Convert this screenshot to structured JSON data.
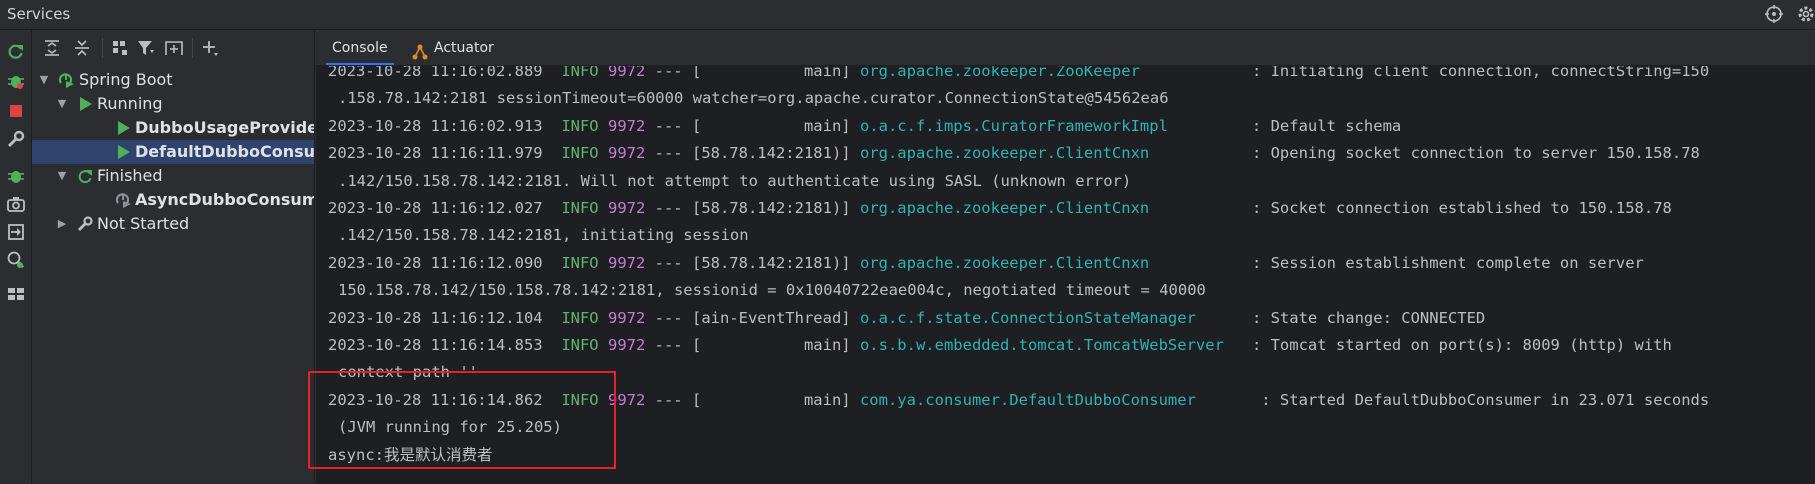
{
  "window": {
    "title": "Services"
  },
  "toolbar": {
    "buttons": [
      "expand-all-icon",
      "collapse-all-icon",
      "group-by-icon",
      "filter-icon",
      "new-tab-icon",
      "add-icon"
    ]
  },
  "side_toolbar": {
    "buttons": [
      "rerun-icon",
      "debug-icon",
      "stop-icon",
      "settings-icon",
      "debug-attach-icon",
      "screenshot-icon",
      "exit-icon",
      "profiler-icon",
      "layout-icon"
    ]
  },
  "tree": {
    "root": "Spring Boot",
    "running_group": "Running",
    "running_items": [
      "DubboUsageProviderAp",
      "DefaultDubboConsume"
    ],
    "finished_group": "Finished",
    "finished_items": [
      "AsyncDubboConsumer"
    ],
    "not_started_group": "Not Started"
  },
  "tabs": [
    {
      "label": "Console",
      "active": true
    },
    {
      "label": "Actuator",
      "active": false
    }
  ],
  "console": {
    "lines": [
      {
        "ts": "2023-10-28 11:16:02.889",
        "level": "INFO",
        "pid": "9972",
        "sep": " --- ",
        "thread": "[           main]",
        "logger": "org.apache.zookeeper.ZooKeeper",
        "pad": "           ",
        "msg": ": Initiating client connection, connectString=150"
      },
      {
        "cont": ".158.78.142:2181 sessionTimeout=60000 watcher=org.apache.curator.ConnectionState@54562ea6"
      },
      {
        "ts": "2023-10-28 11:16:02.913",
        "level": "INFO",
        "pid": "9972",
        "sep": " --- ",
        "thread": "[           main]",
        "logger": "o.a.c.f.imps.CuratorFrameworkImpl",
        "pad": "        ",
        "msg": ": Default schema"
      },
      {
        "ts": "2023-10-28 11:16:11.979",
        "level": "INFO",
        "pid": "9972",
        "sep": " --- ",
        "thread": "[58.78.142:2181)]",
        "logger": "org.apache.zookeeper.ClientCnxn",
        "pad": "          ",
        "msg": ": Opening socket connection to server 150.158.78"
      },
      {
        "cont": ".142/150.158.78.142:2181. Will not attempt to authenticate using SASL (unknown error)"
      },
      {
        "ts": "2023-10-28 11:16:12.027",
        "level": "INFO",
        "pid": "9972",
        "sep": " --- ",
        "thread": "[58.78.142:2181)]",
        "logger": "org.apache.zookeeper.ClientCnxn",
        "pad": "          ",
        "msg": ": Socket connection established to 150.158.78"
      },
      {
        "cont": ".142/150.158.78.142:2181, initiating session"
      },
      {
        "ts": "2023-10-28 11:16:12.090",
        "level": "INFO",
        "pid": "9972",
        "sep": " --- ",
        "thread": "[58.78.142:2181)]",
        "logger": "org.apache.zookeeper.ClientCnxn",
        "pad": "          ",
        "msg": ": Session establishment complete on server"
      },
      {
        "cont": "150.158.78.142/150.158.78.142:2181, sessionid = 0x10040722eae004c, negotiated timeout = 40000"
      },
      {
        "ts": "2023-10-28 11:16:12.104",
        "level": "INFO",
        "pid": "9972",
        "sep": " --- ",
        "thread": "[ain-EventThread]",
        "logger": "o.a.c.f.state.ConnectionStateManager",
        "pad": "     ",
        "msg": ": State change: CONNECTED"
      },
      {
        "ts": "2023-10-28 11:16:14.853",
        "level": "INFO",
        "pid": "9972",
        "sep": " --- ",
        "thread": "[           main]",
        "logger": "o.s.b.w.embedded.tomcat.TomcatWebServer",
        "pad": "  ",
        "msg": ": Tomcat started on port(s): 8009 (http) with"
      },
      {
        "cont": "context path ''"
      },
      {
        "ts": "2023-10-28 11:16:14.862",
        "level": "INFO",
        "pid": "9972",
        "sep": " --- ",
        "thread": "[           main]",
        "logger": "com.ya.consumer.DefaultDubboConsumer",
        "pad": "      ",
        "msg": ": Started DefaultDubboConsumer in 23.071 seconds"
      },
      {
        "cont": "(JVM running for 25.205)"
      },
      {
        "plain": "async:我是默认消费者"
      }
    ]
  },
  "colors": {
    "accent": "#3574f0",
    "info_level": "#5fb56c",
    "pid": "#c77dd8",
    "logger": "#2fb3b3",
    "highlight_box": "#e8202a",
    "run_green": "#4fb05a",
    "stop_red": "#e0423f"
  }
}
